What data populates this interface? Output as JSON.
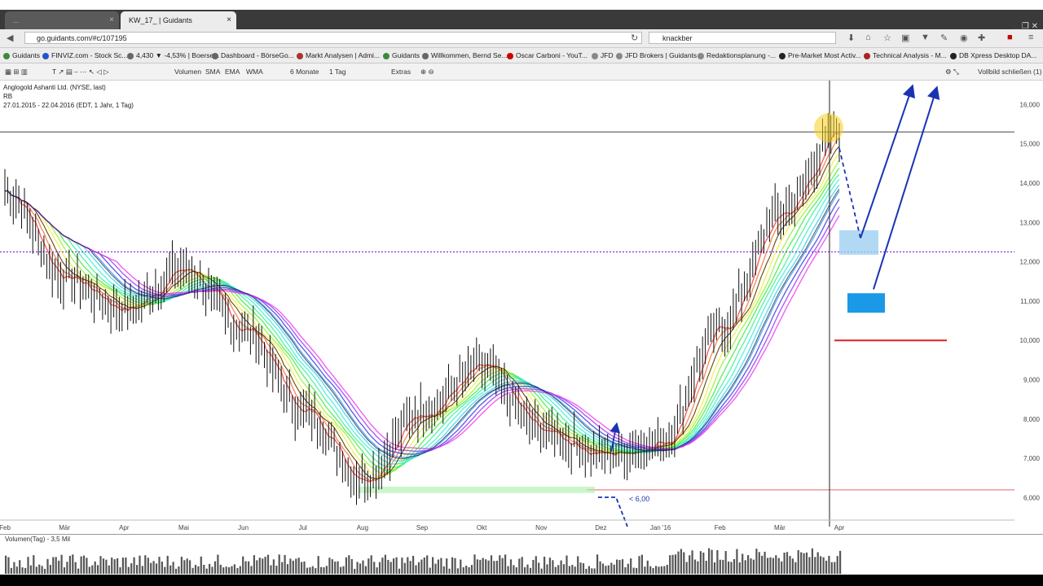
{
  "browser": {
    "tabs": [
      {
        "label": "...",
        "active": false
      },
      {
        "label": "KW_17_ | Guidants",
        "active": true
      }
    ],
    "url": "go.guidants.com/#c/107195",
    "search": "knackber",
    "bookmarks": [
      "Guidants",
      "FINVIZ.com - Stock Sc...",
      "4,430 ▼ -4,53% | Boerse...",
      "Dashboard - BörseGo...",
      "Markt Analysen | Admi...",
      "Guidants",
      "Willkommen, Bernd Se...",
      "Oscar Carboni - YouT...",
      "JFD",
      "JFD Brokers | Guidants",
      "Redaktionsplanung -...",
      "Pre-Market Most Activ...",
      "Technical Analysis - M...",
      "DB Xpress Desktop DA..."
    ]
  },
  "toolbar": {
    "items": [
      "Volumen",
      "SMA",
      "EMA",
      "WMA",
      "6 Monate",
      "1 Tag",
      "Extras"
    ],
    "right": "Vollbild schließen (1)"
  },
  "instrument": {
    "name": "Anglogold Ashanti Ltd. (NYSE, last)",
    "sub": "RB",
    "range": "27.01.2015 - 22.04.2016 (EDT, 1 Jahr, 1 Tag)"
  },
  "annotations": {
    "low_label": "< 6,00"
  },
  "volume": {
    "label": "Volumen(Tag) - 3,5 Mil"
  },
  "colors": {
    "price": "#111111",
    "arrow": "#1a33b3",
    "box_light": "#9fd0f0",
    "box_dark": "#1a9ae6",
    "support_red": "#e02020",
    "purple_line": "#8a2be2",
    "green_zone": "#a8f0a8"
  },
  "chart_data": {
    "type": "line",
    "title": "Anglogold Ashanti Ltd. (NYSE, last)",
    "x": [
      "Feb",
      "Mär",
      "Apr",
      "Mai",
      "Jun",
      "Jul",
      "Aug",
      "Sep",
      "Okt",
      "Nov",
      "Dez",
      "Jan '16",
      "Feb",
      "Mär",
      "Apr"
    ],
    "series": [
      {
        "values": [
          13.8,
          11.6,
          10.8,
          11.8,
          10.3,
          8.2,
          6.5,
          8.2,
          9.3,
          7.7,
          7.1,
          7.4,
          10.3,
          13.2,
          15.3
        ]
      }
    ],
    "y_ticks": [
      16.0,
      15.0,
      14.0,
      13.0,
      12.0,
      11.0,
      10.0,
      9.0,
      8.0,
      7.0,
      6.0
    ],
    "ylim": [
      5.7,
      16.4
    ],
    "horizontal_levels": [
      15.3,
      12.25,
      10.0,
      6.2
    ],
    "grid": false
  }
}
